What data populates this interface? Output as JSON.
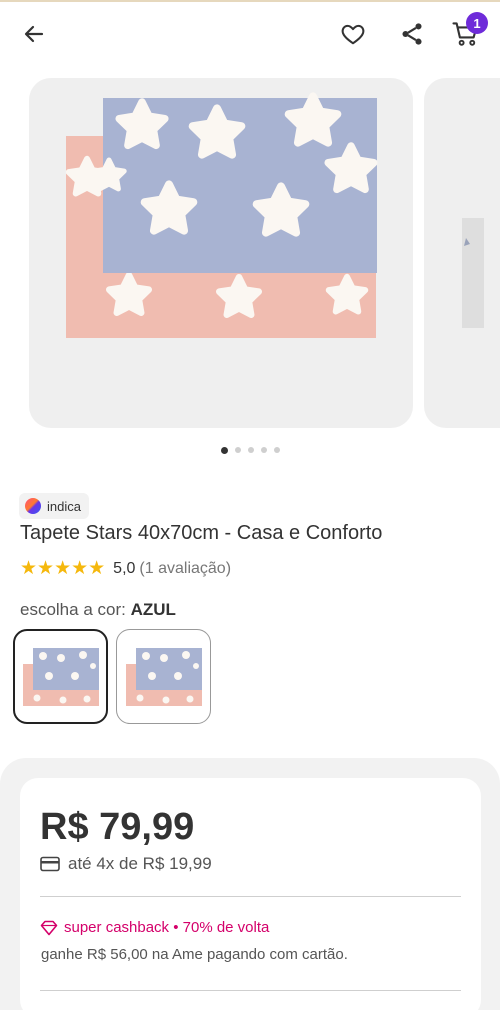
{
  "header": {
    "cart_count": "1"
  },
  "carousel": {
    "total_images": 5,
    "active_index": 0
  },
  "product": {
    "brand": "indica",
    "title": "Tapete Stars 40x70cm - Casa e Conforto",
    "rating_value": "5,0",
    "rating_count": "(1 avaliação)",
    "stars": "★★★★★"
  },
  "color": {
    "label": "escolha a cor:",
    "selected": "AZUL"
  },
  "price": {
    "value": "R$ 79,99",
    "installments": "até 4x de R$ 19,99",
    "cashback": "super cashback • 70% de volta",
    "ame": "ganhe R$ 56,00 na Ame pagando com cartão."
  },
  "colors": {
    "accent": "#6e2bd9",
    "cashback": "#d4006a",
    "star": "#f5b80d"
  }
}
